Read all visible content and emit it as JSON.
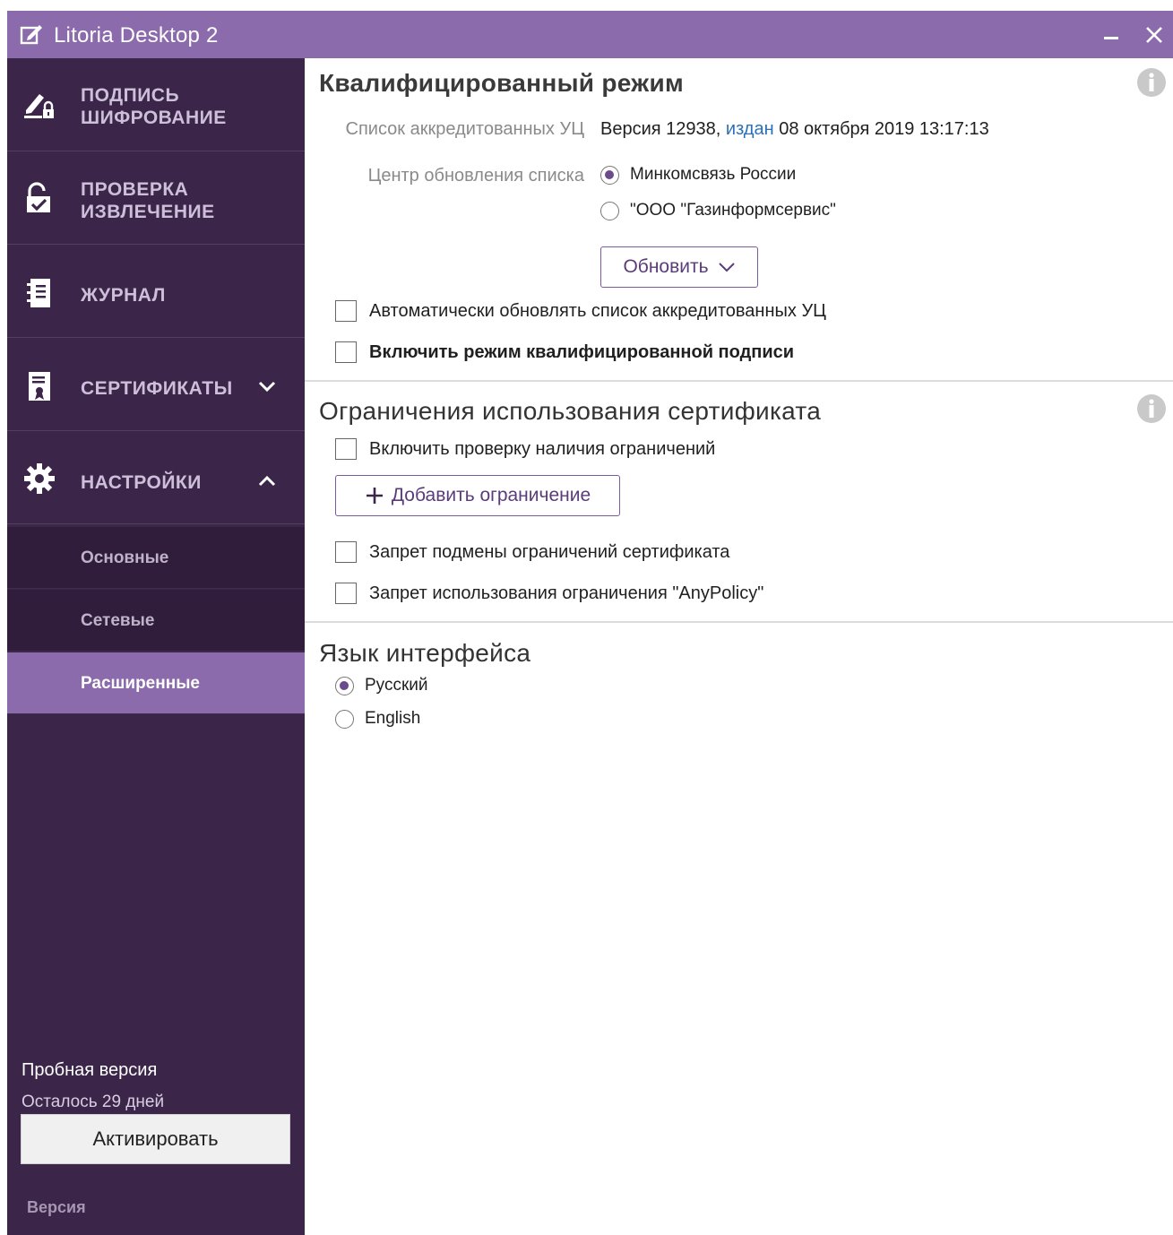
{
  "window": {
    "title": "Litoria Desktop 2",
    "titlebar_color": "#8b6bab"
  },
  "sidebar": {
    "bg_color": "#3b2649",
    "items": [
      {
        "line1": "ПОДПИСЬ",
        "line2": "ШИФРОВАНИЕ",
        "icon": "pen-lock-icon"
      },
      {
        "line1": "ПРОВЕРКА",
        "line2": "ИЗВЛЕЧЕНИЕ",
        "icon": "unlock-check-icon"
      },
      {
        "line1": "ЖУРНАЛ",
        "icon": "journal-icon"
      },
      {
        "line1": "СЕРТИФИКАТЫ",
        "icon": "certificate-icon",
        "expanded": false
      },
      {
        "line1": "НАСТРОЙКИ",
        "icon": "gear-icon",
        "expanded": true
      }
    ],
    "settings_sub": [
      {
        "label": "Основные",
        "active": false
      },
      {
        "label": "Сетевые",
        "active": false
      },
      {
        "label": "Расширенные",
        "active": true
      }
    ],
    "trial_title": "Пробная версия",
    "trial_days": "Осталось 29 дней",
    "activate_label": "Активировать",
    "version_label": "Версия"
  },
  "content": {
    "qualified": {
      "title": "Квалифицированный режим",
      "ca_list_label": "Список аккредитованных УЦ",
      "ca_list_version": "Версия 12938,",
      "ca_list_link": "издан",
      "ca_list_date": "08 октября 2019 13:17:13",
      "update_center_label": "Центр обновления списка",
      "update_centers": [
        {
          "label": "Минкомсвязь России",
          "checked": true
        },
        {
          "label": "\"ООО \"Газинформсервис\"",
          "checked": false
        }
      ],
      "update_button": "Обновить",
      "auto_update": {
        "label": "Автоматически обновлять список аккредитованных УЦ",
        "checked": false
      },
      "enable_qualified": {
        "label": "Включить режим квалифицированной подписи",
        "checked": false
      }
    },
    "restrictions": {
      "title": "Ограничения использования сертификата",
      "enable_check": {
        "label": "Включить проверку наличия ограничений",
        "checked": false
      },
      "add_button": "Добавить ограничение",
      "forbid_substitution": {
        "label": "Запрет подмены ограничений сертификата",
        "checked": false
      },
      "forbid_anypolicy": {
        "label": "Запрет использования ограничения \"AnyPolicy\"",
        "checked": false
      }
    },
    "language": {
      "title": "Язык интерфейса",
      "options": [
        {
          "label": "Русский",
          "checked": true
        },
        {
          "label": "English",
          "checked": false
        }
      ]
    }
  }
}
